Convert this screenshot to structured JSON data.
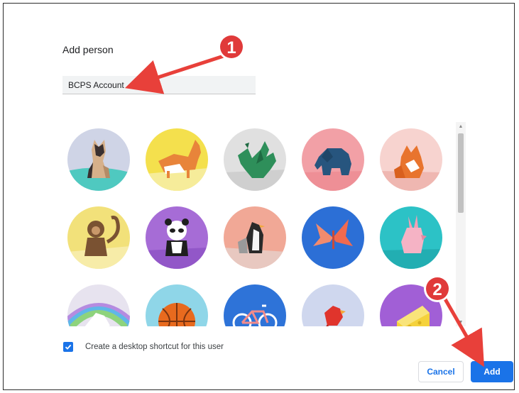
{
  "dialog": {
    "title": "Add person",
    "name_value": "BCPS Account",
    "avatars": [
      {
        "name": "cat"
      },
      {
        "name": "corgi"
      },
      {
        "name": "dragon"
      },
      {
        "name": "elephant"
      },
      {
        "name": "fox"
      },
      {
        "name": "monkey"
      },
      {
        "name": "panda"
      },
      {
        "name": "penguin"
      },
      {
        "name": "butterfly"
      },
      {
        "name": "rabbit"
      },
      {
        "name": "unicorn"
      },
      {
        "name": "basketball"
      },
      {
        "name": "bicycle"
      },
      {
        "name": "bird"
      },
      {
        "name": "cheese"
      }
    ],
    "shortcut_label": "Create a desktop shortcut for this user",
    "shortcut_checked": true,
    "cancel_label": "Cancel",
    "add_label": "Add"
  },
  "annotations": {
    "badge_1": "1",
    "badge_2": "2",
    "badge_color": "#e03a3a",
    "arrow_color": "#e8403a"
  },
  "colors": {
    "accent": "#1a73e8"
  }
}
